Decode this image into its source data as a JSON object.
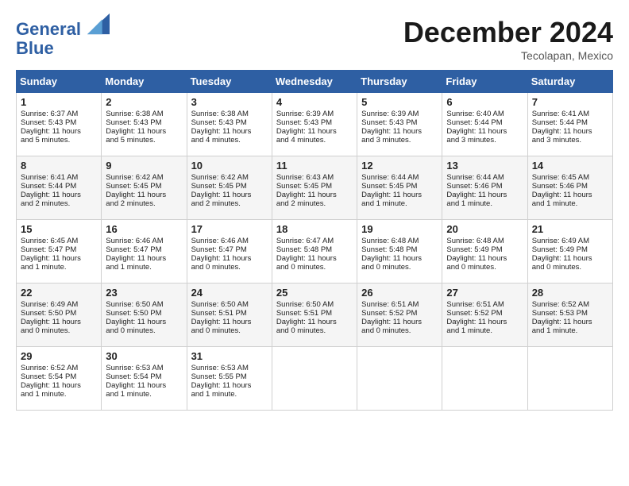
{
  "header": {
    "logo_line1": "General",
    "logo_line2": "Blue",
    "month_title": "December 2024",
    "subtitle": "Tecolapan, Mexico"
  },
  "weekdays": [
    "Sunday",
    "Monday",
    "Tuesday",
    "Wednesday",
    "Thursday",
    "Friday",
    "Saturday"
  ],
  "weeks": [
    [
      {
        "day": "1",
        "lines": [
          "Sunrise: 6:37 AM",
          "Sunset: 5:43 PM",
          "Daylight: 11 hours",
          "and 5 minutes."
        ]
      },
      {
        "day": "2",
        "lines": [
          "Sunrise: 6:38 AM",
          "Sunset: 5:43 PM",
          "Daylight: 11 hours",
          "and 5 minutes."
        ]
      },
      {
        "day": "3",
        "lines": [
          "Sunrise: 6:38 AM",
          "Sunset: 5:43 PM",
          "Daylight: 11 hours",
          "and 4 minutes."
        ]
      },
      {
        "day": "4",
        "lines": [
          "Sunrise: 6:39 AM",
          "Sunset: 5:43 PM",
          "Daylight: 11 hours",
          "and 4 minutes."
        ]
      },
      {
        "day": "5",
        "lines": [
          "Sunrise: 6:39 AM",
          "Sunset: 5:43 PM",
          "Daylight: 11 hours",
          "and 3 minutes."
        ]
      },
      {
        "day": "6",
        "lines": [
          "Sunrise: 6:40 AM",
          "Sunset: 5:44 PM",
          "Daylight: 11 hours",
          "and 3 minutes."
        ]
      },
      {
        "day": "7",
        "lines": [
          "Sunrise: 6:41 AM",
          "Sunset: 5:44 PM",
          "Daylight: 11 hours",
          "and 3 minutes."
        ]
      }
    ],
    [
      {
        "day": "8",
        "lines": [
          "Sunrise: 6:41 AM",
          "Sunset: 5:44 PM",
          "Daylight: 11 hours",
          "and 2 minutes."
        ]
      },
      {
        "day": "9",
        "lines": [
          "Sunrise: 6:42 AM",
          "Sunset: 5:45 PM",
          "Daylight: 11 hours",
          "and 2 minutes."
        ]
      },
      {
        "day": "10",
        "lines": [
          "Sunrise: 6:42 AM",
          "Sunset: 5:45 PM",
          "Daylight: 11 hours",
          "and 2 minutes."
        ]
      },
      {
        "day": "11",
        "lines": [
          "Sunrise: 6:43 AM",
          "Sunset: 5:45 PM",
          "Daylight: 11 hours",
          "and 2 minutes."
        ]
      },
      {
        "day": "12",
        "lines": [
          "Sunrise: 6:44 AM",
          "Sunset: 5:45 PM",
          "Daylight: 11 hours",
          "and 1 minute."
        ]
      },
      {
        "day": "13",
        "lines": [
          "Sunrise: 6:44 AM",
          "Sunset: 5:46 PM",
          "Daylight: 11 hours",
          "and 1 minute."
        ]
      },
      {
        "day": "14",
        "lines": [
          "Sunrise: 6:45 AM",
          "Sunset: 5:46 PM",
          "Daylight: 11 hours",
          "and 1 minute."
        ]
      }
    ],
    [
      {
        "day": "15",
        "lines": [
          "Sunrise: 6:45 AM",
          "Sunset: 5:47 PM",
          "Daylight: 11 hours",
          "and 1 minute."
        ]
      },
      {
        "day": "16",
        "lines": [
          "Sunrise: 6:46 AM",
          "Sunset: 5:47 PM",
          "Daylight: 11 hours",
          "and 1 minute."
        ]
      },
      {
        "day": "17",
        "lines": [
          "Sunrise: 6:46 AM",
          "Sunset: 5:47 PM",
          "Daylight: 11 hours",
          "and 0 minutes."
        ]
      },
      {
        "day": "18",
        "lines": [
          "Sunrise: 6:47 AM",
          "Sunset: 5:48 PM",
          "Daylight: 11 hours",
          "and 0 minutes."
        ]
      },
      {
        "day": "19",
        "lines": [
          "Sunrise: 6:48 AM",
          "Sunset: 5:48 PM",
          "Daylight: 11 hours",
          "and 0 minutes."
        ]
      },
      {
        "day": "20",
        "lines": [
          "Sunrise: 6:48 AM",
          "Sunset: 5:49 PM",
          "Daylight: 11 hours",
          "and 0 minutes."
        ]
      },
      {
        "day": "21",
        "lines": [
          "Sunrise: 6:49 AM",
          "Sunset: 5:49 PM",
          "Daylight: 11 hours",
          "and 0 minutes."
        ]
      }
    ],
    [
      {
        "day": "22",
        "lines": [
          "Sunrise: 6:49 AM",
          "Sunset: 5:50 PM",
          "Daylight: 11 hours",
          "and 0 minutes."
        ]
      },
      {
        "day": "23",
        "lines": [
          "Sunrise: 6:50 AM",
          "Sunset: 5:50 PM",
          "Daylight: 11 hours",
          "and 0 minutes."
        ]
      },
      {
        "day": "24",
        "lines": [
          "Sunrise: 6:50 AM",
          "Sunset: 5:51 PM",
          "Daylight: 11 hours",
          "and 0 minutes."
        ]
      },
      {
        "day": "25",
        "lines": [
          "Sunrise: 6:50 AM",
          "Sunset: 5:51 PM",
          "Daylight: 11 hours",
          "and 0 minutes."
        ]
      },
      {
        "day": "26",
        "lines": [
          "Sunrise: 6:51 AM",
          "Sunset: 5:52 PM",
          "Daylight: 11 hours",
          "and 0 minutes."
        ]
      },
      {
        "day": "27",
        "lines": [
          "Sunrise: 6:51 AM",
          "Sunset: 5:52 PM",
          "Daylight: 11 hours",
          "and 1 minute."
        ]
      },
      {
        "day": "28",
        "lines": [
          "Sunrise: 6:52 AM",
          "Sunset: 5:53 PM",
          "Daylight: 11 hours",
          "and 1 minute."
        ]
      }
    ],
    [
      {
        "day": "29",
        "lines": [
          "Sunrise: 6:52 AM",
          "Sunset: 5:54 PM",
          "Daylight: 11 hours",
          "and 1 minute."
        ]
      },
      {
        "day": "30",
        "lines": [
          "Sunrise: 6:53 AM",
          "Sunset: 5:54 PM",
          "Daylight: 11 hours",
          "and 1 minute."
        ]
      },
      {
        "day": "31",
        "lines": [
          "Sunrise: 6:53 AM",
          "Sunset: 5:55 PM",
          "Daylight: 11 hours",
          "and 1 minute."
        ]
      },
      null,
      null,
      null,
      null
    ]
  ]
}
